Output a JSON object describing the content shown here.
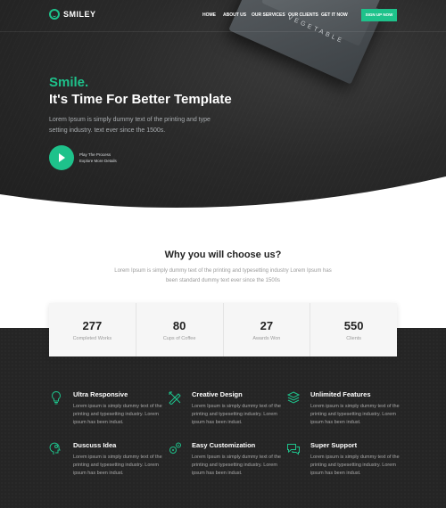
{
  "brand": {
    "name": "SMILEY",
    "accent": "#1ec28b"
  },
  "nav": {
    "items": [
      "HOME",
      "ABOUT US",
      "OUR SERVICES",
      "OUR CLIENTS",
      "GET IT NOW"
    ],
    "cta": "SIGN UP NOW"
  },
  "hero": {
    "kicker": "Smile.",
    "title": "It's Time For Better Template",
    "text": "Lorem Ipsum is simply dummy text of the printing and type setting industry. text ever since the 1500s.",
    "book_text": "VEGETABLE",
    "play_line1": "Play The Process",
    "play_line2": "Explore More Details"
  },
  "why": {
    "title": "Why you will choose us?",
    "text": "Lorem Ipsum is simply dummy text of the printing and typesetting industry Lorem Ipsum has been standard dummy text ever since the 1500s"
  },
  "stats": [
    {
      "number": "277",
      "label": "Completed Works"
    },
    {
      "number": "80",
      "label": "Cups of Coffee"
    },
    {
      "number": "27",
      "label": "Awards Won"
    },
    {
      "number": "550",
      "label": "Clients"
    }
  ],
  "features": [
    {
      "title": "Ultra Responsive",
      "text": "Lorem ipsum is simply dummy text of the printing and typesetting industry. Lorem ipsum has been indust.",
      "icon": "lightbulb-icon"
    },
    {
      "title": "Creative Design",
      "text": "Lorem Ipsum is simply dummy text of the printing and typesetting industry. Lorem ipsum has been indust.",
      "icon": "pencil-ruler-icon"
    },
    {
      "title": "Unlimited Features",
      "text": "Lorem ipsum is simply dummy text of the printing and typesetting industry. Lorem ipsum has been indust.",
      "icon": "layers-icon"
    },
    {
      "title": "Duscuss Idea",
      "text": "Lorem ipsum is simply dummy text of the printing and typesetting industry. Lorem ipsum has been indust.",
      "icon": "head-idea-icon"
    },
    {
      "title": "Easy Customization",
      "text": "Lorem Ipsum is simply dummy text of the printing and typesetting industry. Lorem ipsum has been indust.",
      "icon": "gears-icon"
    },
    {
      "title": "Super Support",
      "text": "Lorem ipsum is simply dummy text of the printing and typesetting industry. Lorem ipsum has been indust.",
      "icon": "chat-bubbles-icon"
    }
  ]
}
